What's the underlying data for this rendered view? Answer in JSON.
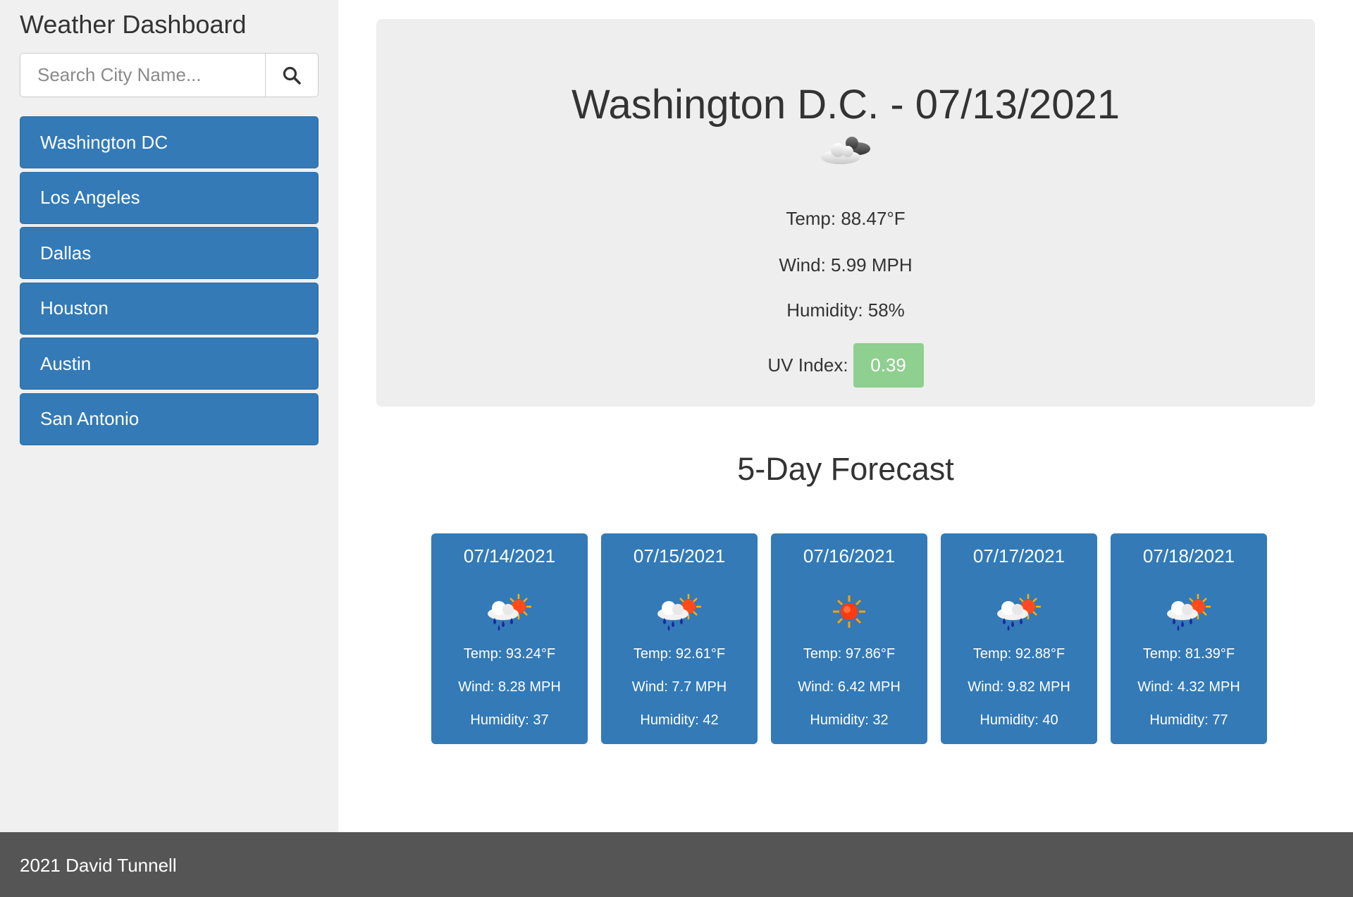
{
  "app": {
    "title": "Weather Dashboard"
  },
  "search": {
    "placeholder": "Search City Name...",
    "value": "",
    "button_icon": "search-icon"
  },
  "sidebar": {
    "cities": [
      "Washington DC",
      "Los Angeles",
      "Dallas",
      "Houston",
      "Austin",
      "San Antonio"
    ]
  },
  "current": {
    "title": "Washington D.C. - 07/13/2021",
    "icon": "partly-cloudy-icon",
    "temp": "Temp: 88.47°F",
    "wind": "Wind: 5.99 MPH",
    "humidity": "Humidity: 58%",
    "uv_label": "UV Index:",
    "uv_value": "0.39"
  },
  "forecast": {
    "heading": "5-Day Forecast",
    "days": [
      {
        "date": "07/14/2021",
        "icon": "rain-sun-icon",
        "temp": "Temp: 93.24°F",
        "wind": "Wind: 8.28 MPH",
        "humidity": "Humidity: 37"
      },
      {
        "date": "07/15/2021",
        "icon": "rain-sun-icon",
        "temp": "Temp: 92.61°F",
        "wind": "Wind: 7.7 MPH",
        "humidity": "Humidity: 42"
      },
      {
        "date": "07/16/2021",
        "icon": "sun-icon",
        "temp": "Temp: 97.86°F",
        "wind": "Wind: 6.42 MPH",
        "humidity": "Humidity: 32"
      },
      {
        "date": "07/17/2021",
        "icon": "rain-sun-icon",
        "temp": "Temp: 92.88°F",
        "wind": "Wind: 9.82 MPH",
        "humidity": "Humidity: 40"
      },
      {
        "date": "07/18/2021",
        "icon": "rain-sun-icon",
        "temp": "Temp: 81.39°F",
        "wind": "Wind: 4.32 MPH",
        "humidity": "Humidity: 77"
      }
    ]
  },
  "footer": {
    "text": "2021 David Tunnell"
  },
  "colors": {
    "primary": "#337ab7",
    "uv_good": "#8fcf8f",
    "sidebar_bg": "#f0f0f0",
    "footer_bg": "#555555",
    "card_bg": "#eeeeee"
  }
}
